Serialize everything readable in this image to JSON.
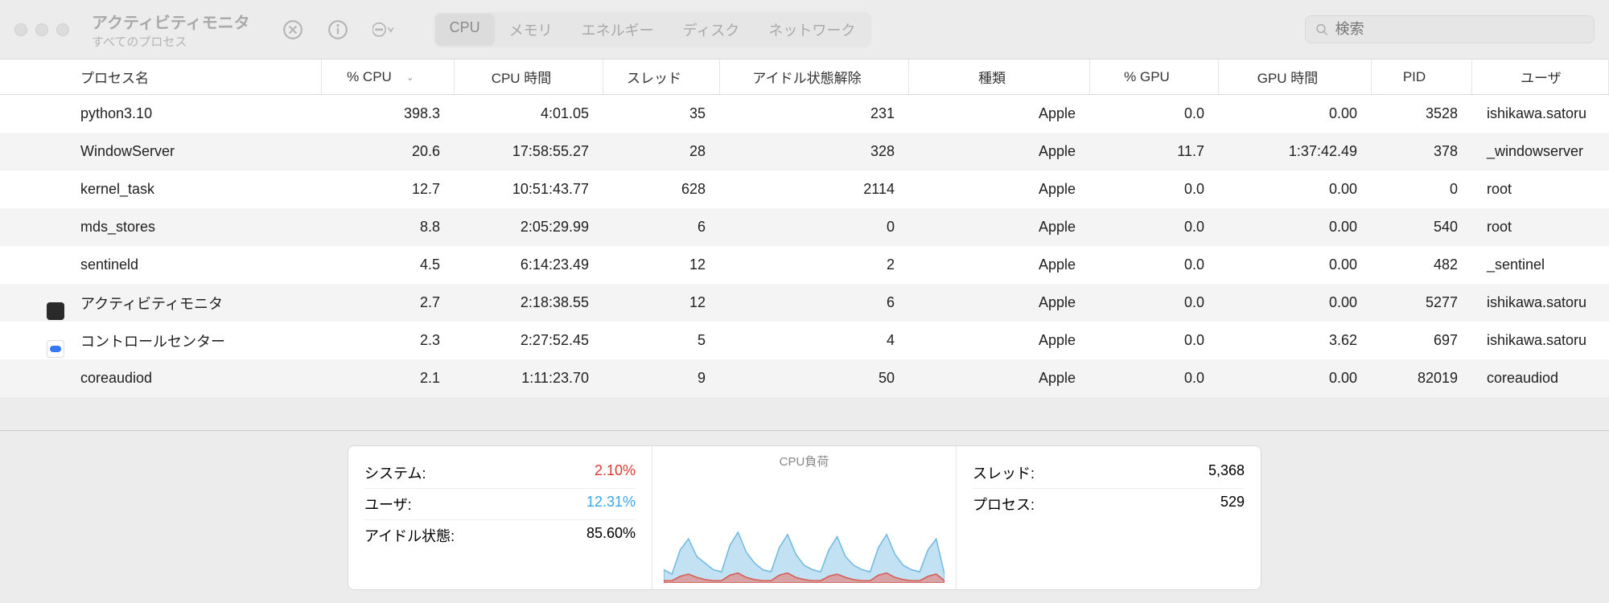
{
  "window": {
    "title": "アクティビティモニタ",
    "subtitle": "すべてのプロセス"
  },
  "tabs": {
    "items": [
      "CPU",
      "メモリ",
      "エネルギー",
      "ディスク",
      "ネットワーク"
    ],
    "active": 0
  },
  "search": {
    "placeholder": "検索"
  },
  "columns": {
    "name": "プロセス名",
    "cpu": "% CPU",
    "time": "CPU 時間",
    "threads": "スレッド",
    "idle": "アイドル状態解除",
    "kind": "種類",
    "gpu": "% GPU",
    "gput": "GPU 時間",
    "pid": "PID",
    "user": "ユーザ"
  },
  "processes": [
    {
      "icon": "",
      "name": "python3.10",
      "cpu": "398.3",
      "time": "4:01.05",
      "threads": "35",
      "idle": "231",
      "kind": "Apple",
      "gpu": "0.0",
      "gput": "0.00",
      "pid": "3528",
      "user": "ishikawa.satoru"
    },
    {
      "icon": "",
      "name": "WindowServer",
      "cpu": "20.6",
      "time": "17:58:55.27",
      "threads": "28",
      "idle": "328",
      "kind": "Apple",
      "gpu": "11.7",
      "gput": "1:37:42.49",
      "pid": "378",
      "user": "_windowserver"
    },
    {
      "icon": "",
      "name": "kernel_task",
      "cpu": "12.7",
      "time": "10:51:43.77",
      "threads": "628",
      "idle": "2114",
      "kind": "Apple",
      "gpu": "0.0",
      "gput": "0.00",
      "pid": "0",
      "user": "root"
    },
    {
      "icon": "",
      "name": "mds_stores",
      "cpu": "8.8",
      "time": "2:05:29.99",
      "threads": "6",
      "idle": "0",
      "kind": "Apple",
      "gpu": "0.0",
      "gput": "0.00",
      "pid": "540",
      "user": "root"
    },
    {
      "icon": "",
      "name": "sentineld",
      "cpu": "4.5",
      "time": "6:14:23.49",
      "threads": "12",
      "idle": "2",
      "kind": "Apple",
      "gpu": "0.0",
      "gput": "0.00",
      "pid": "482",
      "user": "_sentinel"
    },
    {
      "icon": "dark",
      "name": "アクティビティモニタ",
      "cpu": "2.7",
      "time": "2:18:38.55",
      "threads": "12",
      "idle": "6",
      "kind": "Apple",
      "gpu": "0.0",
      "gput": "0.00",
      "pid": "5277",
      "user": "ishikawa.satoru"
    },
    {
      "icon": "blue",
      "name": "コントロールセンター",
      "cpu": "2.3",
      "time": "2:27:52.45",
      "threads": "5",
      "idle": "4",
      "kind": "Apple",
      "gpu": "0.0",
      "gput": "3.62",
      "pid": "697",
      "user": "ishikawa.satoru"
    },
    {
      "icon": "",
      "name": "coreaudiod",
      "cpu": "2.1",
      "time": "1:11:23.70",
      "threads": "9",
      "idle": "50",
      "kind": "Apple",
      "gpu": "0.0",
      "gput": "0.00",
      "pid": "82019",
      "user": "coreaudiod"
    }
  ],
  "footer": {
    "left": {
      "system_label": "システム:",
      "system_value": "2.10%",
      "user_label": "ユーザ:",
      "user_value": "12.31%",
      "idle_label": "アイドル状態:",
      "idle_value": "85.60%"
    },
    "mid": {
      "title": "CPU負荷"
    },
    "right": {
      "threads_label": "スレッド:",
      "threads_value": "5,368",
      "procs_label": "プロセス:",
      "procs_value": "529"
    }
  },
  "chart_data": {
    "type": "area",
    "title": "CPU負荷",
    "xlabel": "",
    "ylabel": "",
    "ylim": [
      0,
      100
    ],
    "series": [
      {
        "name": "user",
        "color": "#a8d6f0",
        "values": [
          12,
          8,
          30,
          40,
          24,
          18,
          12,
          10,
          34,
          46,
          28,
          18,
          12,
          10,
          32,
          44,
          26,
          16,
          12,
          10,
          30,
          42,
          24,
          16,
          12,
          10,
          32,
          44,
          26,
          16,
          12,
          10,
          30,
          40,
          8
        ]
      },
      {
        "name": "system",
        "color": "#e47a72",
        "values": [
          2,
          2,
          6,
          8,
          5,
          3,
          2,
          2,
          7,
          9,
          5,
          3,
          2,
          2,
          7,
          9,
          5,
          3,
          2,
          2,
          6,
          8,
          5,
          3,
          2,
          2,
          7,
          9,
          5,
          3,
          2,
          2,
          6,
          8,
          2
        ]
      }
    ]
  }
}
